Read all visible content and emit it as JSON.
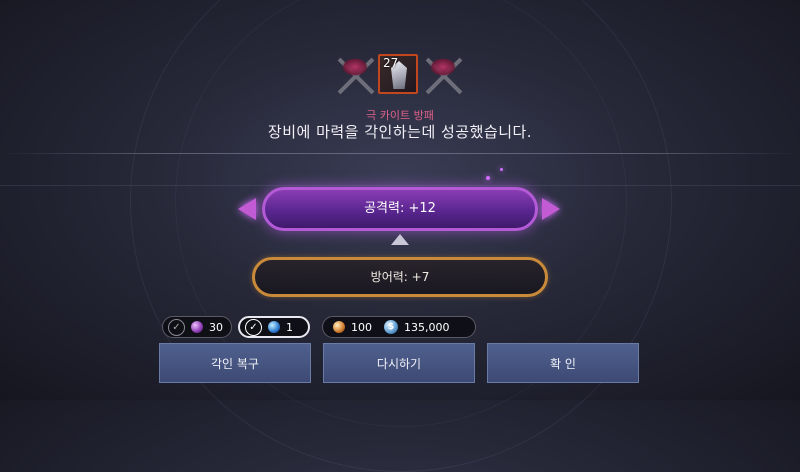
{
  "item": {
    "level": "27",
    "name": "극 카이트 방패",
    "icon": "kite-shield-icon"
  },
  "result": {
    "message": "장비에 마력을 각인하는데 성공했습니다."
  },
  "stats": {
    "attack": "공격력: +12",
    "defense": "방어력: +7"
  },
  "costs": {
    "purple_stone": {
      "count": "30",
      "icon": "purple-gem-icon",
      "selected": false
    },
    "blue_stone": {
      "count": "1",
      "icon": "blue-gem-icon",
      "selected": true
    },
    "orange_stone": {
      "count": "100",
      "icon": "orange-gem-icon"
    },
    "silver": {
      "count": "135,000",
      "icon": "silver-coin-icon"
    }
  },
  "buttons": {
    "restore": "각인 복구",
    "retry": "다시하기",
    "confirm": "확 인"
  },
  "colors": {
    "item_name": "#e0608a",
    "attack_bar": "#8a3db3",
    "defense_border": "#c98a3a",
    "button": "#50608e"
  }
}
